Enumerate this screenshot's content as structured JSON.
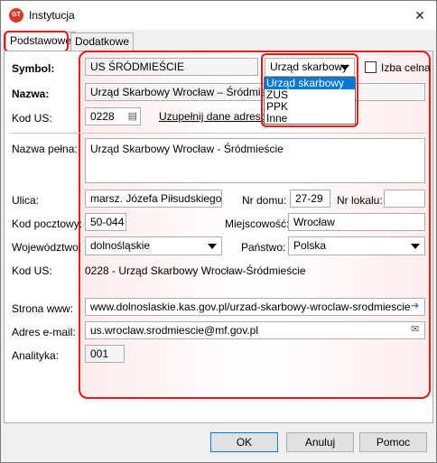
{
  "window": {
    "title": "Instytucja",
    "app_icon_text": "GT"
  },
  "tabs": [
    {
      "label": "Podstawowe"
    },
    {
      "label": "Dodatkowe"
    }
  ],
  "form": {
    "symbol": {
      "label": "Symbol:",
      "value": "US ŚRÓDMIEŚCIE"
    },
    "type_combo": {
      "value": "Urząd skarbowy",
      "options": [
        "Urząd skarbowy",
        "ZUS",
        "PPK",
        "Inne"
      ]
    },
    "izba_celna": {
      "label": "Izba celna",
      "checked": false
    },
    "nazwa": {
      "label": "Nazwa:",
      "value": "Urząd Skarbowy Wrocław – Śródmieście"
    },
    "kod_us": {
      "label": "Kod US:",
      "value": "0228",
      "link": "Uzupełnij dane adresowe"
    },
    "nazwa_pelna": {
      "label": "Nazwa pełna:",
      "value": "Urząd Skarbowy Wrocław - Śródmieście"
    },
    "ulica": {
      "label": "Ulica:",
      "value": "marsz. Józefa Piłsudskiego"
    },
    "nr_domu": {
      "label": "Nr domu:",
      "value": "27-29"
    },
    "nr_lokalu": {
      "label": "Nr lokalu:",
      "value": ""
    },
    "kod_pocztowy": {
      "label": "Kod pocztowy:",
      "value": "50-044"
    },
    "miejscowosc": {
      "label": "Miejscowość:",
      "value": "Wrocław"
    },
    "wojewodztwo": {
      "label": "Województwo:",
      "value": "dolnośląskie"
    },
    "panstwo": {
      "label": "Państwo:",
      "value": "Polska"
    },
    "kod_us_info": {
      "label": "Kod US:",
      "value": "0228 - Urząd Skarbowy Wrocław-Śródmieście"
    },
    "strona_www": {
      "label": "Strona www:",
      "value": "www.dolnoslaskie.kas.gov.pl/urzad-skarbowy-wroclaw-srodmiescie"
    },
    "email": {
      "label": "Adres e-mail:",
      "value": "us.wroclaw.srodmiescie@mf.gov.pl"
    },
    "analityka": {
      "label": "Analityka:",
      "value": "001"
    }
  },
  "buttons": {
    "ok": "OK",
    "cancel": "Anuluj",
    "help": "Pomoc"
  },
  "colors": {
    "highlight": "#e01a1a",
    "selection": "#0078d7"
  }
}
